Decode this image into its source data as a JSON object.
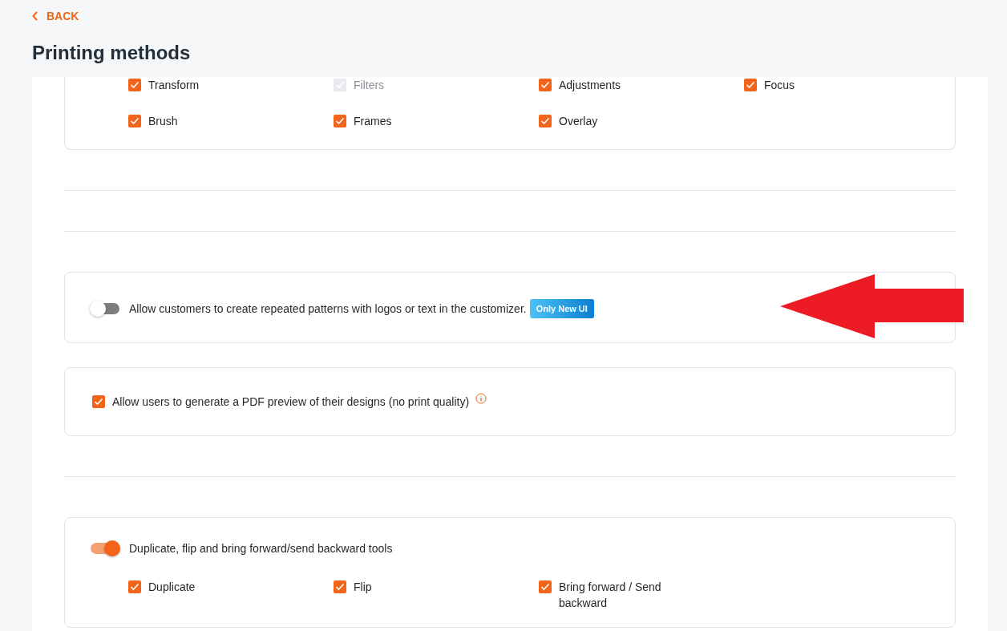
{
  "back_link": "BACK",
  "title": "Printing methods",
  "sections": [
    {
      "kind": "options",
      "options": [
        {
          "label": "Transform",
          "checked": true,
          "disabled": false
        },
        {
          "label": "Filters",
          "checked": true,
          "disabled": true
        },
        {
          "label": "Adjustments",
          "checked": true,
          "disabled": false
        },
        {
          "label": "Focus",
          "checked": true,
          "disabled": false
        },
        {
          "label": "Brush",
          "checked": true,
          "disabled": false
        },
        {
          "label": "Frames",
          "checked": true,
          "disabled": false
        },
        {
          "label": "Overlay",
          "checked": true,
          "disabled": false
        }
      ]
    },
    {
      "kind": "divider"
    },
    {
      "kind": "divider"
    },
    {
      "kind": "toggle",
      "on": false,
      "label": "Allow customers to create repeated patterns with logos or text in the customizer.",
      "badge": "Only New UI"
    },
    {
      "kind": "check",
      "checked": true,
      "label": "Allow users to generate a PDF preview of their designs (no print quality)"
    },
    {
      "kind": "divider"
    },
    {
      "kind": "toggle",
      "on": true,
      "label": "Duplicate, flip and bring forward/send backward tools",
      "options": [
        {
          "label": "Duplicate",
          "checked": true,
          "disabled": false
        },
        {
          "label": "Flip",
          "checked": true,
          "disabled": false
        },
        {
          "label": "Bring forward / Send backward",
          "checked": true,
          "disabled": false
        }
      ]
    }
  ]
}
